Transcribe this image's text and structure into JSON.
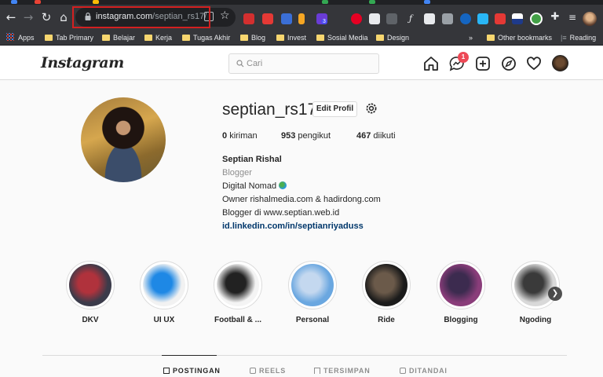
{
  "browser": {
    "url_host": "instagram.com",
    "url_path": "/septian_rs17/",
    "bookmarks": [
      {
        "label": "Apps",
        "kind": "apps"
      },
      {
        "label": "Tab Primary",
        "kind": "folder"
      },
      {
        "label": "Belajar",
        "kind": "folder"
      },
      {
        "label": "Kerja",
        "kind": "folder"
      },
      {
        "label": "Tugas Akhir",
        "kind": "folder"
      },
      {
        "label": "Blog",
        "kind": "folder"
      },
      {
        "label": "Invest",
        "kind": "folder"
      },
      {
        "label": "Sosial Media",
        "kind": "folder"
      },
      {
        "label": "Design",
        "kind": "folder"
      }
    ],
    "overflow_chevron": "»",
    "other_bookmarks": "Other bookmarks",
    "reading_list": "Reading",
    "extension_badge": "3"
  },
  "instagram": {
    "logo": "Instagram",
    "search_placeholder": "Cari",
    "messages_badge": "1",
    "profile": {
      "username": "septian_rs17",
      "edit_profile_label": "Edit Profil",
      "posts_count": "0",
      "posts_label": "kiriman",
      "followers_count": "953",
      "followers_label": "pengikut",
      "following_count": "467",
      "following_label": "diikuti",
      "full_name": "Septian Rishal",
      "category": "Blogger",
      "bio_line1": "Digital Nomad",
      "bio_line2": "Owner rishalmedia.com & hadirdong.com",
      "bio_line3": "Blogger di www.septian.web.id",
      "link": "id.linkedin.com/in/septianriyaduss"
    },
    "highlights": [
      {
        "label": "DKV",
        "colors": [
          "#3b3b4a",
          "#b0323c"
        ]
      },
      {
        "label": "UI UX",
        "colors": [
          "#f2f2f2",
          "#1e88e5"
        ]
      },
      {
        "label": "Football & ...",
        "colors": [
          "#f4f4f4",
          "#222222"
        ]
      },
      {
        "label": "Personal",
        "colors": [
          "#6aa7e0",
          "#c4d8ef"
        ]
      },
      {
        "label": "Ride",
        "colors": [
          "#1b1b1b",
          "#6b5a4a"
        ]
      },
      {
        "label": "Blogging",
        "colors": [
          "#8a3d7a",
          "#3c2b4f"
        ]
      },
      {
        "label": "Ngoding",
        "colors": [
          "#d9d9d9",
          "#3a3a3a"
        ]
      }
    ],
    "tabs": [
      {
        "label": "POSTINGAN",
        "active": true
      },
      {
        "label": "REELS",
        "active": false
      },
      {
        "label": "TERSIMPAN",
        "active": false
      },
      {
        "label": "DITANDAI",
        "active": false
      }
    ]
  },
  "colors": {
    "annotation_red": "#d32020",
    "link_blue": "#00376b",
    "badge_red": "#ed4956"
  }
}
